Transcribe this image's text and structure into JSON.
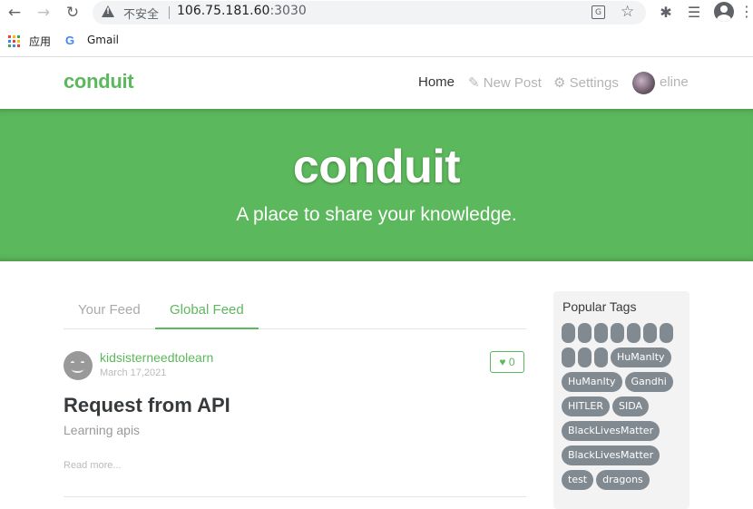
{
  "browser": {
    "insecure_label": "不安全",
    "url_host": "106.75.181.60",
    "url_port": ":3030",
    "bookmarks": [
      {
        "label": "应用",
        "icon": "apps-grid-icon"
      },
      {
        "label": "Gmail",
        "icon": "google-g-icon"
      }
    ],
    "icons": [
      "back-arrow-icon",
      "forward-arrow-icon",
      "reload-icon",
      "warning-icon",
      "translate-icon",
      "star-icon",
      "extensions-icon",
      "reading-list-icon",
      "profile-icon",
      "menu-icon"
    ]
  },
  "navbar": {
    "brand": "conduit",
    "home": "Home",
    "new_post": "New Post",
    "settings": "Settings",
    "username": "eline"
  },
  "banner": {
    "title": "conduit",
    "subtitle": "A place to share your knowledge."
  },
  "feed": {
    "tabs": [
      "Your Feed",
      "Global Feed"
    ],
    "active_tab": "Global Feed",
    "articles": [
      {
        "author": "kidsisterneedtolearn",
        "date": "March 17,2021",
        "favorites": "0",
        "title": "Request from API",
        "description": "Learning apis",
        "read_more": "Read more..."
      }
    ]
  },
  "sidebar": {
    "title": "Popular Tags",
    "tags": [
      "",
      "",
      "",
      "",
      "",
      "",
      "",
      "",
      "",
      "",
      "HuManIty",
      "HuManIty",
      "Gandhi",
      "HITLER",
      "SIDA",
      "BlackLivesMatter",
      "BlackLivesMatter",
      "test",
      "dragons"
    ]
  },
  "colors": {
    "brand_green": "#5cb85c",
    "tag_gray": "#818a91",
    "sidebar_bg": "#f3f3f3"
  }
}
